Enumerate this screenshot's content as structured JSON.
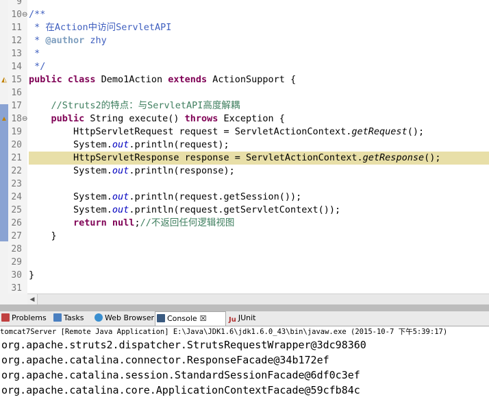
{
  "editor": {
    "lines": [
      {
        "n": "9",
        "tokens": []
      },
      {
        "n": "10",
        "tokens": [
          {
            "c": "jd",
            "t": "/**"
          }
        ]
      },
      {
        "n": "11",
        "tokens": [
          {
            "c": "jd",
            "t": " * 在Action中访问ServletAPI"
          }
        ]
      },
      {
        "n": "12",
        "tokens": [
          {
            "c": "jd",
            "t": " * "
          },
          {
            "c": "jt",
            "t": "@author"
          },
          {
            "c": "jd",
            "t": " zhy"
          }
        ]
      },
      {
        "n": "13",
        "tokens": [
          {
            "c": "jd",
            "t": " *"
          }
        ]
      },
      {
        "n": "14",
        "tokens": [
          {
            "c": "jd",
            "t": " */"
          }
        ]
      },
      {
        "n": "15",
        "tokens": [
          {
            "c": "kw",
            "t": "public class"
          },
          {
            "c": "",
            "t": " Demo1Action "
          },
          {
            "c": "kw",
            "t": "extends"
          },
          {
            "c": "",
            "t": " ActionSupport {"
          }
        ]
      },
      {
        "n": "16",
        "tokens": []
      },
      {
        "n": "17",
        "tokens": [
          {
            "c": "cm",
            "t": "    //Struts2的特点：与ServletAPI高度解耦"
          }
        ]
      },
      {
        "n": "18",
        "tokens": [
          {
            "c": "",
            "t": "    "
          },
          {
            "c": "kw",
            "t": "public"
          },
          {
            "c": "",
            "t": " String execute() "
          },
          {
            "c": "kw",
            "t": "throws"
          },
          {
            "c": "",
            "t": " Exception {"
          }
        ]
      },
      {
        "n": "19",
        "tokens": [
          {
            "c": "",
            "t": "        HttpServletRequest request = ServletActionContext."
          },
          {
            "c": "mi",
            "t": "getRequest"
          },
          {
            "c": "",
            "t": "();"
          }
        ]
      },
      {
        "n": "20",
        "tokens": [
          {
            "c": "",
            "t": "        System."
          },
          {
            "c": "fd",
            "t": "out"
          },
          {
            "c": "",
            "t": ".println(request);"
          }
        ]
      },
      {
        "n": "21",
        "tokens": [
          {
            "c": "",
            "t": "        HttpServletResponse response = ServletActionContext."
          },
          {
            "c": "mi",
            "t": "getResponse"
          },
          {
            "c": "",
            "t": "();"
          }
        ]
      },
      {
        "n": "22",
        "tokens": [
          {
            "c": "",
            "t": "        System."
          },
          {
            "c": "fd",
            "t": "out"
          },
          {
            "c": "",
            "t": ".println(response);"
          }
        ]
      },
      {
        "n": "23",
        "tokens": []
      },
      {
        "n": "24",
        "tokens": [
          {
            "c": "",
            "t": "        System."
          },
          {
            "c": "fd",
            "t": "out"
          },
          {
            "c": "",
            "t": ".println(request.getSession());"
          }
        ]
      },
      {
        "n": "25",
        "tokens": [
          {
            "c": "",
            "t": "        System."
          },
          {
            "c": "fd",
            "t": "out"
          },
          {
            "c": "",
            "t": ".println(request.getServletContext());"
          }
        ]
      },
      {
        "n": "26",
        "tokens": [
          {
            "c": "",
            "t": "        "
          },
          {
            "c": "kw",
            "t": "return null"
          },
          {
            "c": "",
            "t": ";"
          },
          {
            "c": "cm",
            "t": "//不返回任何逻辑视图"
          }
        ]
      },
      {
        "n": "27",
        "tokens": [
          {
            "c": "",
            "t": "    }"
          }
        ]
      },
      {
        "n": "28",
        "tokens": []
      },
      {
        "n": "29",
        "tokens": []
      },
      {
        "n": "30",
        "tokens": [
          {
            "c": "",
            "t": "}"
          }
        ]
      },
      {
        "n": "31",
        "tokens": []
      }
    ],
    "highlighted_line": "21",
    "colors": {
      "keyword": "#7f0055",
      "comment": "#3f7f5f",
      "javadoc": "#3f5fbf",
      "field": "#0000c0",
      "highlight": "#e8dfa8"
    }
  },
  "tabs": [
    {
      "label": "Problems",
      "icon": "problems-icon"
    },
    {
      "label": "Tasks",
      "icon": "tasks-icon"
    },
    {
      "label": "Web Browser",
      "icon": "web-browser-icon"
    },
    {
      "label": "Console",
      "icon": "console-icon",
      "active": true,
      "close": "☒"
    },
    {
      "label": "JUnit",
      "icon": "junit-icon",
      "prefix": "Ju"
    }
  ],
  "console": {
    "title": "tomcat7Server [Remote Java Application] E:\\Java\\JDK1.6\\jdk1.6.0_43\\bin\\javaw.exe (2015-10-7 下午5:39:17)",
    "lines": [
      "org.apache.struts2.dispatcher.StrutsRequestWrapper@3dc98360",
      "org.apache.catalina.connector.ResponseFacade@34b172ef",
      "org.apache.catalina.session.StandardSessionFacade@6df0c3ef",
      "org.apache.catalina.core.ApplicationContextFacade@59cfb84c"
    ]
  }
}
